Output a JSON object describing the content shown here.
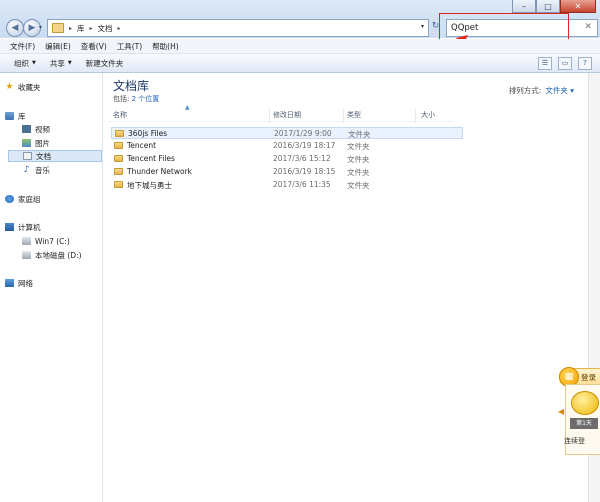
{
  "window": {
    "minimize": "–",
    "maximize": "□",
    "close": "✕"
  },
  "address": {
    "crumbs": [
      "库",
      "文档"
    ],
    "separator": "▸"
  },
  "search": {
    "value": "QQpet",
    "clear": "✕"
  },
  "menubar": {
    "items": [
      "文件(F)",
      "编辑(E)",
      "查看(V)",
      "工具(T)",
      "帮助(H)"
    ]
  },
  "toolbar": {
    "organize": "组织",
    "share": "共享",
    "new_folder": "新建文件夹"
  },
  "sidebar": {
    "favorites": "收藏夹",
    "libraries": "库",
    "videos": "视频",
    "pictures": "图片",
    "documents": "文档",
    "music": "音乐",
    "homegroup": "家庭组",
    "computer": "计算机",
    "drive_c": "Win7 (C:)",
    "drive_d": "本地磁盘 (D:)",
    "network": "网络"
  },
  "library": {
    "title": "文档库",
    "includes_prefix": "包括:",
    "includes_link": "2 个位置",
    "arrange_label": "排列方式:",
    "arrange_value": "文件夹 ▾"
  },
  "columns": {
    "name": "名称",
    "date": "修改日期",
    "type": "类型",
    "size": "大小"
  },
  "files": [
    {
      "name": "360js Files",
      "date": "2017/1/29 9:00",
      "type": "文件夹"
    },
    {
      "name": "Tencent",
      "date": "2016/3/19 18:17",
      "type": "文件夹"
    },
    {
      "name": "Tencent Files",
      "date": "2017/3/6 15:12",
      "type": "文件夹"
    },
    {
      "name": "Thunder Network",
      "date": "2016/3/19 18:15",
      "type": "文件夹"
    },
    {
      "name": "地下城与勇士",
      "date": "2017/3/6 11:35",
      "type": "文件夹"
    }
  ],
  "qq_widget": {
    "title": "登录",
    "chip": "第1天",
    "footer": "连续登"
  },
  "colors": {
    "annotation": "#e0261f",
    "title": "#1e3a6b",
    "link": "#1d62b8"
  }
}
